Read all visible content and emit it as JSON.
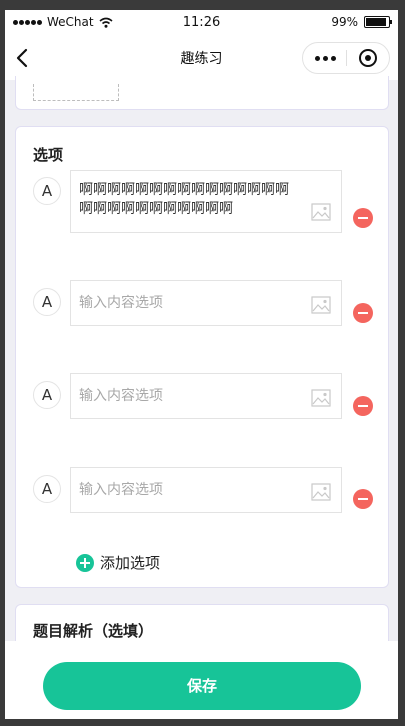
{
  "status_bar": {
    "carrier": "WeChat",
    "time": "11:26",
    "battery": "99%"
  },
  "nav": {
    "title": "趣练习"
  },
  "options_card": {
    "title": "选项",
    "options": [
      {
        "letter": "A",
        "value": "啊啊啊啊啊啊啊啊啊啊啊啊啊啊啊啊啊啊啊啊啊啊啊啊啊啊",
        "placeholder": ""
      },
      {
        "letter": "A",
        "value": "",
        "placeholder": "输入内容选项"
      },
      {
        "letter": "A",
        "value": "",
        "placeholder": "输入内容选项"
      },
      {
        "letter": "A",
        "value": "",
        "placeholder": "输入内容选项"
      }
    ],
    "add_label": "添加选项"
  },
  "analysis_card": {
    "title": "题目解析（选填）"
  },
  "footer": {
    "save_label": "保存"
  },
  "colors": {
    "accent": "#17c498",
    "delete": "#f4655e"
  }
}
